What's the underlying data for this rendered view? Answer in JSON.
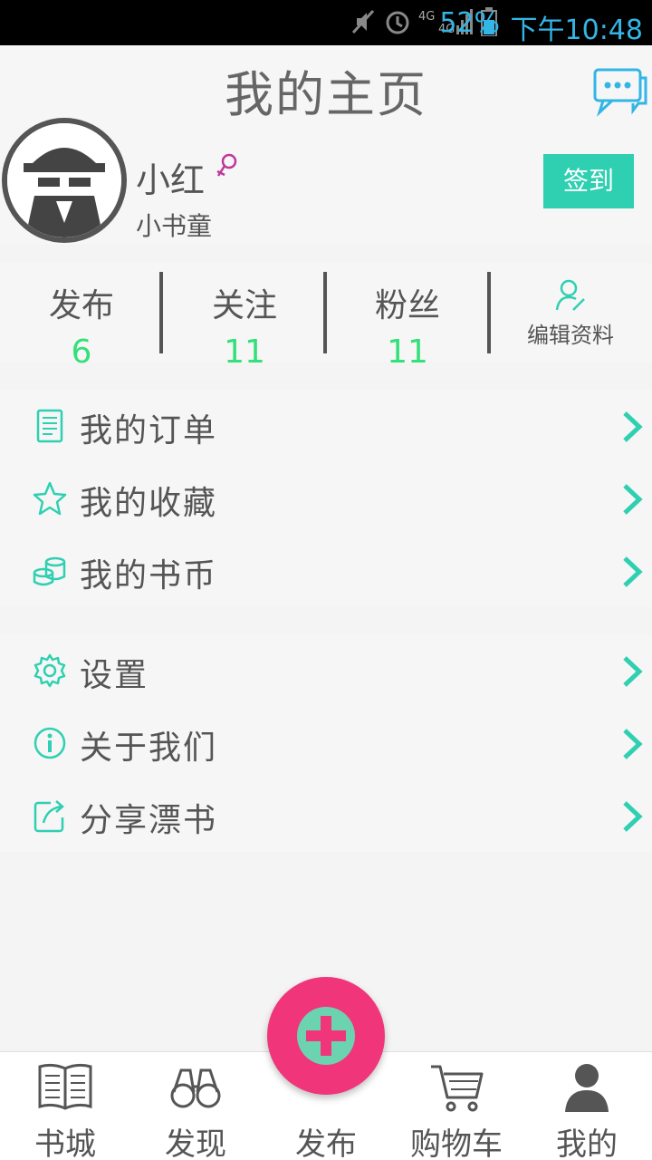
{
  "status_bar": {
    "network": "4G",
    "battery": "52%",
    "time": "下午10:48"
  },
  "header": {
    "title": "我的主页",
    "message_icon": "chat-bubble-icon"
  },
  "profile": {
    "name": "小红",
    "gender_icon": "female-icon",
    "level": "小书童",
    "signin_label": "签到"
  },
  "stats": {
    "publish": {
      "label": "发布",
      "value": "6"
    },
    "follow": {
      "label": "关注",
      "value": "11"
    },
    "fans": {
      "label": "粉丝",
      "value": "11"
    },
    "edit_label": "编辑资料"
  },
  "menu_group1": [
    {
      "label": "我的订单",
      "icon": "order-icon"
    },
    {
      "label": "我的收藏",
      "icon": "star-icon"
    },
    {
      "label": "我的书币",
      "icon": "coins-icon"
    }
  ],
  "menu_group2": [
    {
      "label": "设置",
      "icon": "gear-icon"
    },
    {
      "label": "关于我们",
      "icon": "info-icon"
    },
    {
      "label": "分享漂书",
      "icon": "share-icon"
    }
  ],
  "bottom_nav": [
    {
      "label": "书城",
      "icon": "book-icon"
    },
    {
      "label": "发现",
      "icon": "binoculars-icon"
    },
    {
      "label": "发布",
      "icon": "plus-icon"
    },
    {
      "label": "购物车",
      "icon": "cart-icon"
    },
    {
      "label": "我的",
      "icon": "user-icon"
    }
  ],
  "colors": {
    "accent": "#2fd0b1",
    "stat_value": "#33e07a",
    "fab": "#f0357a"
  }
}
